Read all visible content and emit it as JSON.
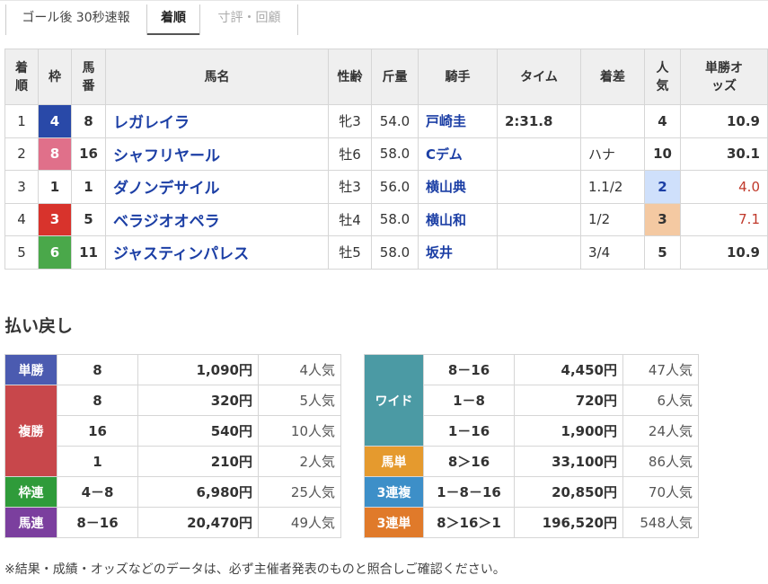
{
  "tabs": [
    {
      "label": "ゴール後 30秒速報"
    },
    {
      "label": "着順"
    },
    {
      "label": "寸評・回顧"
    }
  ],
  "results": {
    "headers": {
      "rank": "着順",
      "waku": "枠",
      "num": "馬番",
      "name": "馬名",
      "sexage": "性齢",
      "weight": "斤量",
      "jockey": "騎手",
      "time": "タイム",
      "margin": "着差",
      "pop": "人気",
      "odds": "単勝オッズ"
    },
    "rows": [
      {
        "rank": "1",
        "waku": "4",
        "num": "8",
        "name": "レガレイラ",
        "sexage": "牝3",
        "weight": "54.0",
        "jockey": "戸崎圭",
        "time": "2:31.8",
        "margin": "",
        "pop": "4",
        "odds": "10.9"
      },
      {
        "rank": "2",
        "waku": "8",
        "num": "16",
        "name": "シャフリヤール",
        "sexage": "牡6",
        "weight": "58.0",
        "jockey": "Cデム",
        "time": "",
        "margin": "ハナ",
        "pop": "10",
        "odds": "30.1"
      },
      {
        "rank": "3",
        "waku": "1",
        "num": "1",
        "name": "ダノンデサイル",
        "sexage": "牡3",
        "weight": "56.0",
        "jockey": "横山典",
        "time": "",
        "margin": "1.1/2",
        "pop": "2",
        "odds": "4.0"
      },
      {
        "rank": "4",
        "waku": "3",
        "num": "5",
        "name": "ベラジオオペラ",
        "sexage": "牡4",
        "weight": "58.0",
        "jockey": "横山和",
        "time": "",
        "margin": "1/2",
        "pop": "3",
        "odds": "7.1"
      },
      {
        "rank": "5",
        "waku": "6",
        "num": "11",
        "name": "ジャスティンパレス",
        "sexage": "牡5",
        "weight": "58.0",
        "jockey": "坂井",
        "time": "",
        "margin": "3/4",
        "pop": "5",
        "odds": "10.9"
      }
    ]
  },
  "payout": {
    "title": "払い戻し",
    "left": {
      "tansho": {
        "label": "単勝",
        "combo": "8",
        "amount": "1,090円",
        "pop": "4人気"
      },
      "fukusho": {
        "label": "複勝",
        "items": [
          {
            "combo": "8",
            "amount": "320円",
            "pop": "5人気"
          },
          {
            "combo": "16",
            "amount": "540円",
            "pop": "10人気"
          },
          {
            "combo": "1",
            "amount": "210円",
            "pop": "2人気"
          }
        ]
      },
      "wakuren": {
        "label": "枠連",
        "combo": "4－8",
        "amount": "6,980円",
        "pop": "25人気"
      },
      "umaren": {
        "label": "馬連",
        "combo": "8－16",
        "amount": "20,470円",
        "pop": "49人気"
      }
    },
    "right": {
      "wide": {
        "label": "ワイド",
        "items": [
          {
            "combo": "8－16",
            "amount": "4,450円",
            "pop": "47人気"
          },
          {
            "combo": "1－8",
            "amount": "720円",
            "pop": "6人気"
          },
          {
            "combo": "1－16",
            "amount": "1,900円",
            "pop": "24人気"
          }
        ]
      },
      "umatan": {
        "label": "馬単",
        "combo": "8＞16",
        "amount": "33,100円",
        "pop": "86人気"
      },
      "sanrenpuku": {
        "label": "3連複",
        "combo": "1－8－16",
        "amount": "20,850円",
        "pop": "70人気"
      },
      "sanrentan": {
        "label": "3連単",
        "combo": "8＞16＞1",
        "amount": "196,520円",
        "pop": "548人気"
      }
    }
  },
  "note": "※結果・成績・オッズなどのデータは、必ず主催者発表のものと照合しご確認ください。",
  "colors": {
    "waku_1": "#ffffff",
    "waku_3": "#d8332c",
    "waku_4": "#2949a8",
    "waku_6": "#4aa84a",
    "waku_8": "#e0708a",
    "horse_link": "#1c3fa5",
    "fav_1": "#cfe0fb",
    "fav_2": "#f4c9a2",
    "odds_highlight": "#c0392b"
  }
}
